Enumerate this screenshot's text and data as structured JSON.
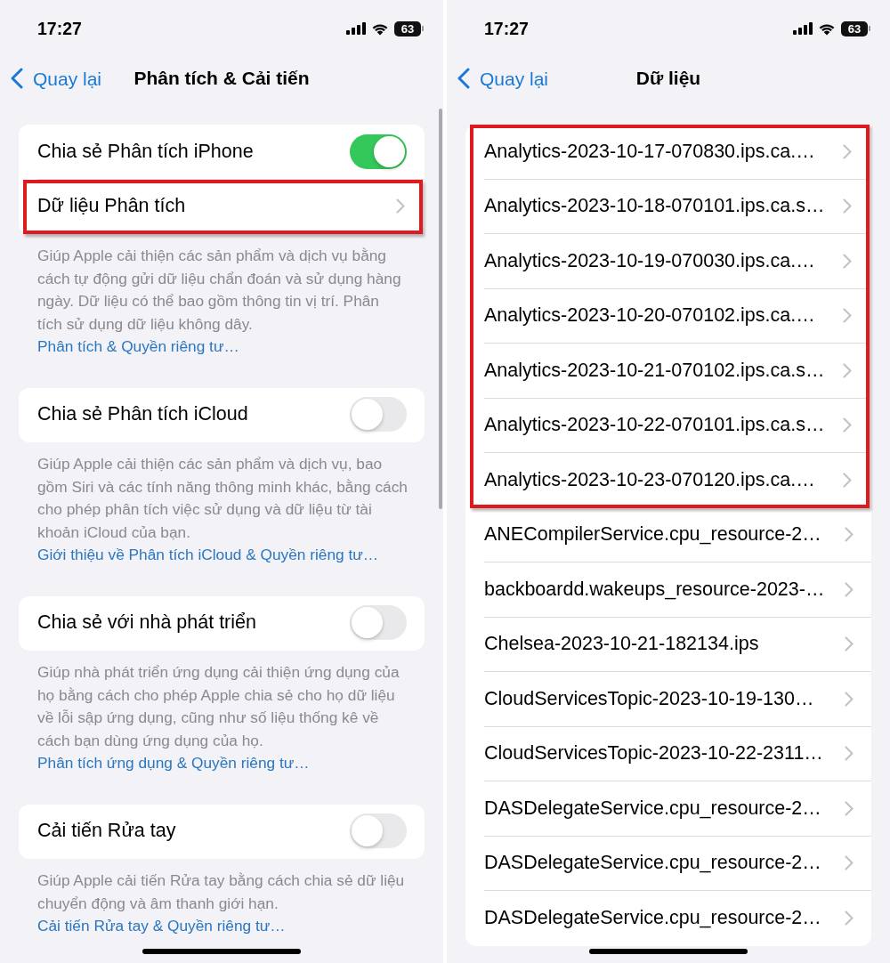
{
  "screens": [
    {
      "status_bar": {
        "time": "17:27",
        "battery": "63"
      },
      "nav": {
        "back": "Quay lại",
        "title": "Phân tích & Cải tiến"
      },
      "scroll_indicator": true,
      "groups": [
        {
          "sections": [
            {
              "rows": [
                {
                  "kind": "toggle",
                  "label": "Chia sẻ Phân tích iPhone",
                  "on": true
                }
              ]
            },
            {
              "highlighted": true,
              "rows": [
                {
                  "kind": "link",
                  "label": "Dữ liệu Phân tích"
                }
              ]
            }
          ],
          "footer": {
            "text": "Giúp Apple cải thiện các sản phẩm và dịch vụ bằng cách tự động gửi dữ liệu chẩn đoán và sử dụng hàng ngày. Dữ liệu có thể bao gồm thông tin vị trí. Phân tích sử dụng dữ liệu không dây.",
            "link": "Phân tích & Quyền riêng tư…"
          }
        },
        {
          "sections": [
            {
              "rows": [
                {
                  "kind": "toggle",
                  "label": "Chia sẻ Phân tích iCloud",
                  "on": false
                }
              ]
            }
          ],
          "footer": {
            "text": "Giúp Apple cải thiện các sản phẩm và dịch vụ, bao gồm Siri và các tính năng thông minh khác, bằng cách cho phép phân tích việc sử dụng và dữ liệu từ tài khoản iCloud của bạn.",
            "link": "Giới thiệu về Phân tích iCloud & Quyền riêng tư…"
          }
        },
        {
          "sections": [
            {
              "rows": [
                {
                  "kind": "toggle",
                  "label": "Chia sẻ với nhà phát triển",
                  "on": false
                }
              ]
            }
          ],
          "footer": {
            "text": "Giúp nhà phát triển ứng dụng cải thiện ứng dụng của họ bằng cách cho phép Apple chia sẻ cho họ dữ liệu về lỗi sập ứng dụng, cũng như số liệu thống kê về cách bạn dùng ứng dụng của họ.",
            "link": "Phân tích ứng dụng & Quyền riêng tư…"
          }
        },
        {
          "sections": [
            {
              "rows": [
                {
                  "kind": "toggle",
                  "label": "Cải tiến Rửa tay",
                  "on": false
                }
              ]
            }
          ],
          "footer": {
            "text": "Giúp Apple cải tiến Rửa tay bằng cách chia sẻ dữ liệu chuyển động và âm thanh giới hạn.",
            "link": "Cải tiến Rửa tay & Quyền riêng tư…"
          }
        }
      ]
    },
    {
      "status_bar": {
        "time": "17:27",
        "battery": "63"
      },
      "nav": {
        "back": "Quay lại",
        "title": "Dữ liệu"
      },
      "groups": [
        {
          "sections": [
            {
              "highlighted": true,
              "rows": [
                {
                  "kind": "link",
                  "label": "Analytics-2023-10-17-070830.ips.ca.…"
                },
                {
                  "kind": "link",
                  "label": "Analytics-2023-10-18-070101.ips.ca.s…"
                },
                {
                  "kind": "link",
                  "label": "Analytics-2023-10-19-070030.ips.ca.…"
                },
                {
                  "kind": "link",
                  "label": "Analytics-2023-10-20-070102.ips.ca.…"
                },
                {
                  "kind": "link",
                  "label": "Analytics-2023-10-21-070102.ips.ca.s…"
                },
                {
                  "kind": "link",
                  "label": "Analytics-2023-10-22-070101.ips.ca.s…"
                },
                {
                  "kind": "link",
                  "label": "Analytics-2023-10-23-070120.ips.ca.…"
                }
              ]
            },
            {
              "rows": [
                {
                  "kind": "link",
                  "label": "ANECompilerService.cpu_resource-2…"
                },
                {
                  "kind": "link",
                  "label": "backboardd.wakeups_resource-2023-…"
                },
                {
                  "kind": "link",
                  "label": "Chelsea-2023-10-21-182134.ips"
                },
                {
                  "kind": "link",
                  "label": "CloudServicesTopic-2023-10-19-130…"
                },
                {
                  "kind": "link",
                  "label": "CloudServicesTopic-2023-10-22-2311…"
                },
                {
                  "kind": "link",
                  "label": "DASDelegateService.cpu_resource-2…"
                },
                {
                  "kind": "link",
                  "label": "DASDelegateService.cpu_resource-2…"
                },
                {
                  "kind": "link",
                  "label": "DASDelegateService.cpu_resource-2…"
                }
              ]
            }
          ]
        }
      ]
    }
  ]
}
